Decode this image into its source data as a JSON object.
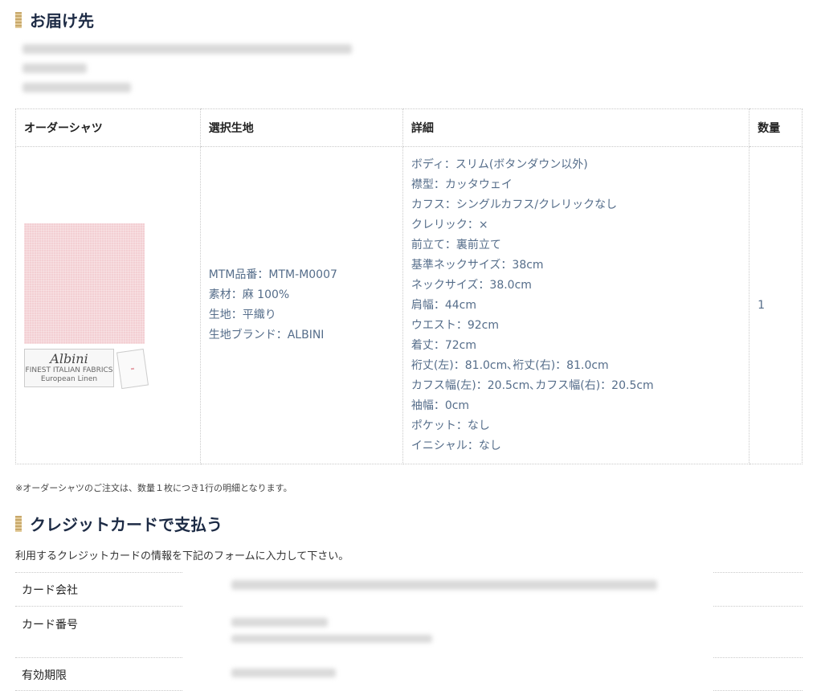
{
  "shipping": {
    "title": "お届け先"
  },
  "order_table": {
    "headers": [
      "オーダーシャツ",
      "選択生地",
      "詳細",
      "数量"
    ],
    "fabric_lines": [
      "MTM品番：MTM-M0007",
      "素材：麻 100%",
      "生地：平織り",
      "生地ブランド：ALBINI"
    ],
    "detail_lines": [
      "ボディ：スリム(ボタンダウン以外)",
      "襟型：カッタウェイ",
      "カフス：シングルカフス/クレリックなし",
      "クレリック：×",
      "前立て：裏前立て",
      "基準ネックサイズ：38cm",
      "ネックサイズ：38.0cm",
      "肩幅：44cm",
      "ウエスト：92cm",
      "着丈：72cm",
      "裄丈(左)：81.0cm､裄丈(右)：81.0cm",
      "カフス幅(左)：20.5cm､カフス幅(右)：20.5cm",
      "袖幅：0cm",
      "ポケット：なし",
      "イニシャル：なし"
    ],
    "quantity": "1",
    "fabric_label": {
      "logo": "Albini",
      "line1": "FINEST ITALIAN FABRICS",
      "line2": "European Linen"
    }
  },
  "note": "※オーダーシャツのご注文は、数量１枚につき1行の明細となります。",
  "payment": {
    "title": "クレジットカードで支払う",
    "intro": "利用するクレジットカードの情報を下記のフォームに入力して下さい。",
    "rows": [
      "カード会社",
      "カード番号",
      "有効期限"
    ]
  }
}
